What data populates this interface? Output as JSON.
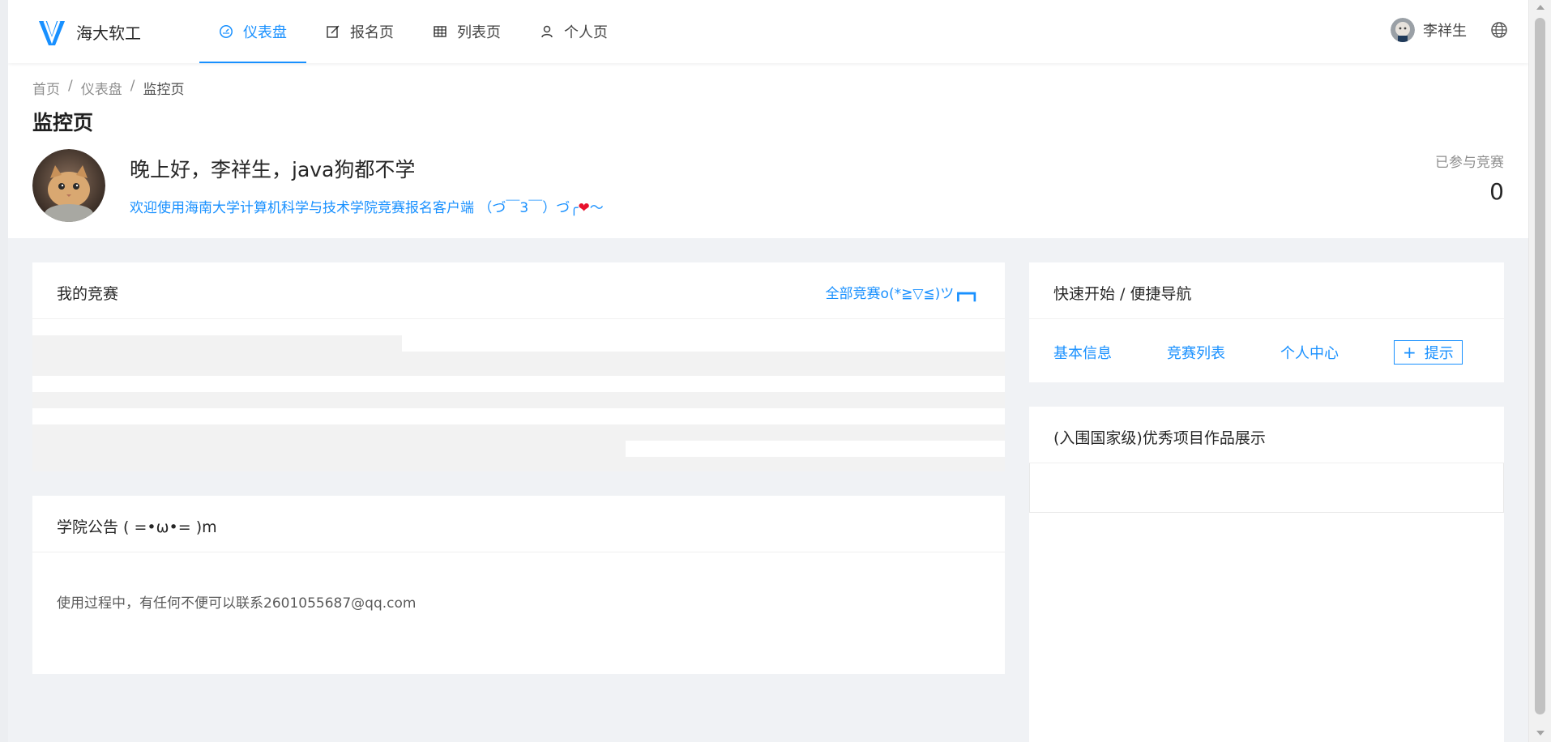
{
  "header": {
    "brand": "海大软工",
    "nav": [
      {
        "label": "仪表盘",
        "icon": "dashboard-icon",
        "active": true
      },
      {
        "label": "报名页",
        "icon": "edit-icon",
        "active": false
      },
      {
        "label": "列表页",
        "icon": "table-icon",
        "active": false
      },
      {
        "label": "个人页",
        "icon": "user-icon",
        "active": false
      }
    ],
    "user_name": "李祥生",
    "language_icon": "globe-icon"
  },
  "breadcrumb": {
    "items": [
      "首页",
      "仪表盘",
      "监控页"
    ],
    "separator": "/"
  },
  "page": {
    "title": "监控页",
    "greeting": "晚上好，李祥生，java狗都不学",
    "welcome_main": "欢迎使用海南大学计算机科学与技术学院竞赛报名客户端 （づ￣3￣）づ╭",
    "welcome_heart": "❤",
    "welcome_tail": "～",
    "stat_label": "已参与竞赛",
    "stat_value": "0"
  },
  "my_competitions": {
    "title": "我的竞赛",
    "all_link": "全部竞赛o(*≧▽≦)ツ┏━┓"
  },
  "announcements": {
    "title": "学院公告 ( =•ω•= )m",
    "text": "使用过程中，有任何不便可以联系2601055687@qq.com"
  },
  "quick_nav": {
    "title": "快速开始 / 便捷导航",
    "links": [
      "基本信息",
      "竞赛列表",
      "个人中心"
    ],
    "add_label": "提示",
    "add_icon": "plus-icon"
  },
  "showcase": {
    "title": "(入围国家级)优秀项目作品展示"
  },
  "colors": {
    "primary": "#1890ff",
    "background": "#f0f2f5",
    "heart": "#e8102b"
  }
}
